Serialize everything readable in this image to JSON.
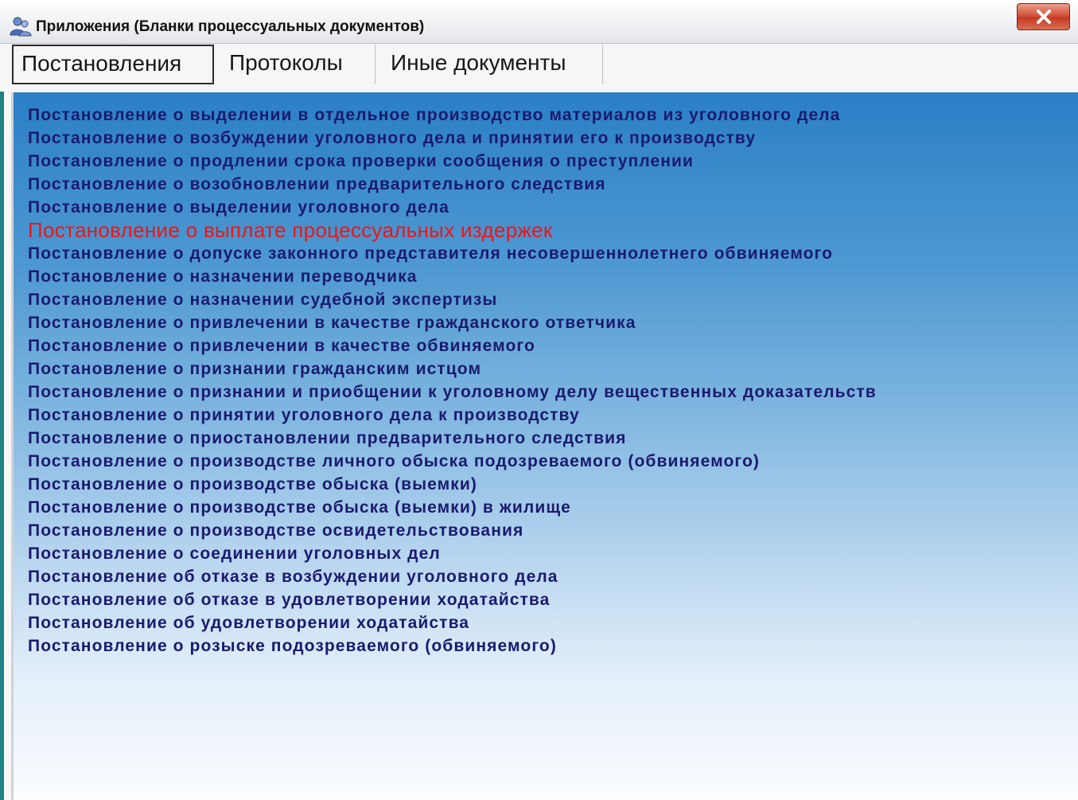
{
  "window": {
    "title": "Приложения (Бланки процессуальных документов)",
    "icon": "users-icon",
    "close_icon": "close-icon"
  },
  "tabs": [
    {
      "label": "Постановления",
      "active": true
    },
    {
      "label": "Протоколы",
      "active": false
    },
    {
      "label": "Иные документы",
      "active": false
    }
  ],
  "colors": {
    "item_text": "#1a1a6e",
    "highlight_text": "#ee1515",
    "panel_top": "#2a7fc6",
    "panel_bottom": "#fbfdff"
  },
  "documents": [
    {
      "label": "Постановление о  выделении в отдельное производство материалов из уголовного дела"
    },
    {
      "label": "Постановление о возбуждении  уголовного дела и принятии его к производству"
    },
    {
      "label": "Постановление о продлении срока проверки сообщения о преступлении"
    },
    {
      "label": "Постановление о возобновлении предварительного следствия"
    },
    {
      "label": "Постановление о выделении уголовного дела"
    },
    {
      "label": "Постановление о выплате процессуальных издержек",
      "highlighted": true
    },
    {
      "label": "Постановление о допуске законного представителя несовершеннолетнего обвиняемого"
    },
    {
      "label": "Постановление о назначении переводчика"
    },
    {
      "label": "Постановление о назначении судебной экспертизы"
    },
    {
      "label": "Постановление о привлечении в качестве гражданского ответчика"
    },
    {
      "label": "Постановление о привлечении в качестве обвиняемого"
    },
    {
      "label": "Постановление о признании гражданским истцом"
    },
    {
      "label": "Постановление о признании и приобщении к уголовному делу вещественных доказательств"
    },
    {
      "label": "Постановление о принятии уголовного дела к производству"
    },
    {
      "label": "Постановление о приостановлении предварительного следствия"
    },
    {
      "label": "Постановление о производстве личного обыска подозреваемого (обвиняемого)"
    },
    {
      "label": "Постановление о производстве обыска (выемки)"
    },
    {
      "label": "Постановление о производстве обыска (выемки) в жилище"
    },
    {
      "label": "Постановление о производстве освидетельствования"
    },
    {
      "label": "Постановление о соединении уголовных дел"
    },
    {
      "label": "Постановление об отказе в возбуждении уголовного дела"
    },
    {
      "label": "Постановление об отказе в удовлетворении ходатайства"
    },
    {
      "label": "Постановление об удовлетворении ходатайства"
    },
    {
      "label": "Постановление о розыске подозреваемого (обвиняемого)"
    }
  ]
}
